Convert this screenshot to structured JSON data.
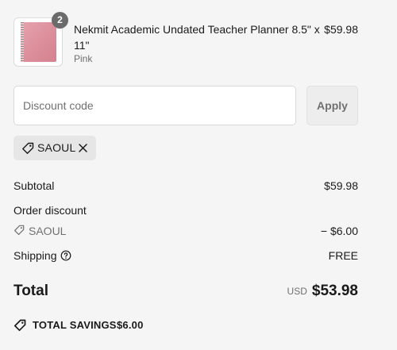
{
  "line_item": {
    "quantity": "2",
    "title": "Nekmit Academic Undated Teacher Planner 8.5\" x 11\"",
    "variant": "Pink",
    "price": "$59.98",
    "image_color": "#db8d9a"
  },
  "discount": {
    "placeholder": "Discount code",
    "value": "",
    "apply_label": "Apply",
    "applied_code": "SAOUL",
    "tag_icon": "tag-icon",
    "remove_icon": "close-icon"
  },
  "summary": {
    "subtotal_label": "Subtotal",
    "subtotal_value": "$59.98",
    "order_discount_label": "Order discount",
    "order_discount_code": "SAOUL",
    "order_discount_value": "− $6.00",
    "shipping_label": "Shipping",
    "shipping_icon": "info-icon",
    "shipping_value": "FREE",
    "total_label": "Total",
    "currency": "USD",
    "total_value": "$53.98",
    "savings_label": "TOTAL SAVINGS",
    "savings_value": "$6.00"
  },
  "colors": {
    "background": "#f5f5f5",
    "text": "#1a1a1a",
    "muted": "#707070",
    "tag_background": "#e6e6e6",
    "button_background": "#ededed"
  }
}
